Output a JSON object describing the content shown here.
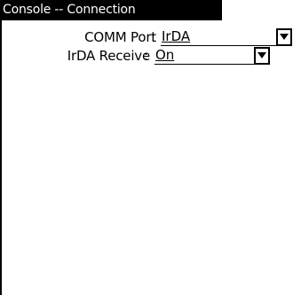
{
  "window": {
    "title": "Console -- Connection"
  },
  "form": {
    "comm_port": {
      "label": "COMM Port",
      "colon": ":",
      "value": "IrDA"
    },
    "irda_receive": {
      "label": "IrDA Receive",
      "colon": ":",
      "value": "On"
    }
  },
  "icons": {
    "dropdown": "chevron-down-icon"
  },
  "colors": {
    "title_bg": "#000000",
    "title_fg": "#ffffff",
    "background": "#ffffff"
  }
}
